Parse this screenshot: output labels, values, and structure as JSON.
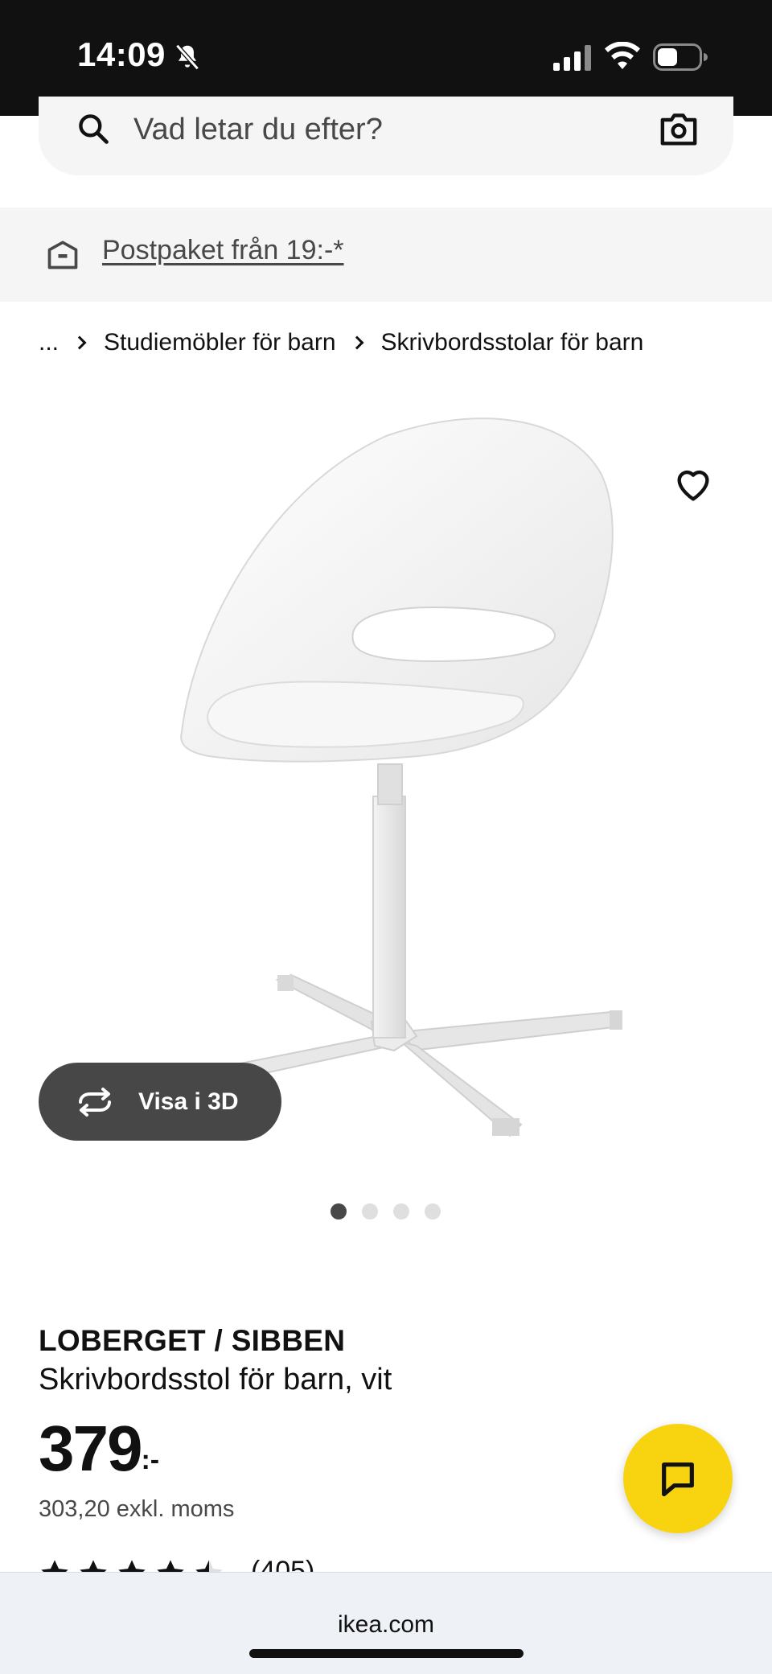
{
  "status_bar": {
    "time": "14:09",
    "icons": [
      "bell-muted-icon",
      "signal-icon",
      "wifi-icon",
      "battery-icon"
    ]
  },
  "search": {
    "placeholder": "Vad letar du efter?",
    "icons": [
      "search-icon",
      "camera-icon"
    ]
  },
  "promo": {
    "text": "Postpaket från 19:-*",
    "icon": "package-icon"
  },
  "breadcrumb": {
    "items": [
      "...",
      "Studiemöbler för barn",
      "Skrivbordsstolar för barn"
    ]
  },
  "gallery": {
    "view_3d_label": "Visa i 3D",
    "total_images": 4,
    "active_index": 0
  },
  "product": {
    "name": "LOBERGET / SIBBEN",
    "description": "Skrivbordsstol för barn, vit",
    "price_main": "379",
    "price_suffix": ":-",
    "price_ex_vat": "303,20 exkl. moms",
    "rating": 4.5,
    "review_count": "(405)"
  },
  "browser": {
    "url": "ikea.com"
  },
  "colors": {
    "chat_button": "#f7d310",
    "view_3d_button": "#474747",
    "status_bar": "#111111"
  }
}
